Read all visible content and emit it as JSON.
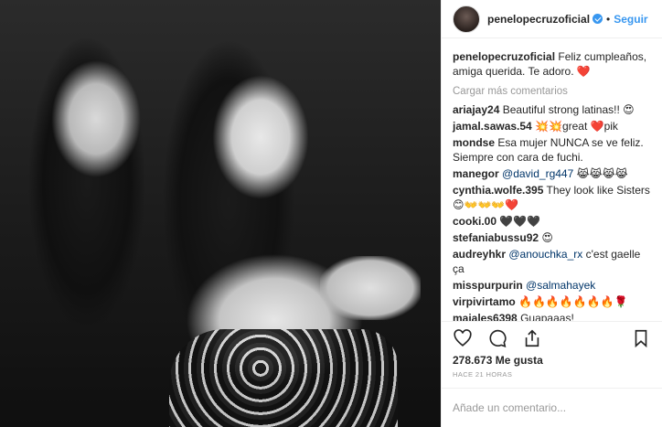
{
  "header": {
    "username": "penelopecruzoficial",
    "separator": "•",
    "follow_label": "Seguir"
  },
  "caption": {
    "username": "penelopecruzoficial",
    "text": "Feliz cumpleaños, amiga querida. Te adoro. ❤️"
  },
  "load_more_label": "Cargar más comentarios",
  "comments": [
    {
      "user": "ariajay24",
      "pre": "",
      "mention": "",
      "text": "Beautiful strong latinas!! 😍"
    },
    {
      "user": "jamal.sawas.54",
      "pre": "",
      "mention": "",
      "text": "💥💥great ❤️pik"
    },
    {
      "user": "mondse",
      "pre": "",
      "mention": "",
      "text": "Esa mujer NUNCA se ve feliz. Siempre con cara de fuchi."
    },
    {
      "user": "manegor",
      "pre": "",
      "mention": "@david_rg447",
      "text": "😹😹😹😹"
    },
    {
      "user": "cynthia.wolfe.395",
      "pre": "",
      "mention": "",
      "text": "They look like Sisters 😊👐👐👐❤️"
    },
    {
      "user": "cooki.00",
      "pre": "",
      "mention": "",
      "text": "🖤🖤🖤"
    },
    {
      "user": "stefaniabussu92",
      "pre": "",
      "mention": "",
      "text": "😍"
    },
    {
      "user": "audreyhkr",
      "pre": "",
      "mention": "@anouchka_rx",
      "text": "c'est gaelle ça"
    },
    {
      "user": "misspurpurin",
      "pre": "",
      "mention": "@salmahayek",
      "text": ""
    },
    {
      "user": "virpivirtamo",
      "pre": "",
      "mention": "",
      "text": "🔥🔥🔥🔥🔥🔥🔥🌹"
    },
    {
      "user": "majales6398",
      "pre": "",
      "mention": "",
      "text": "Guapaaas!"
    }
  ],
  "likes": {
    "count": "278.673",
    "label": "Me gusta"
  },
  "timestamp": "HACE 21 HORAS",
  "add_comment": {
    "placeholder": "Añade un comentario..."
  },
  "icons": {
    "like": "heart-icon",
    "comment": "comment-icon",
    "share": "share-icon",
    "save": "bookmark-icon"
  },
  "colors": {
    "link_blue": "#3897f0",
    "mention_blue": "#003569",
    "text": "#262626",
    "muted": "#999999",
    "border": "#efefef"
  }
}
